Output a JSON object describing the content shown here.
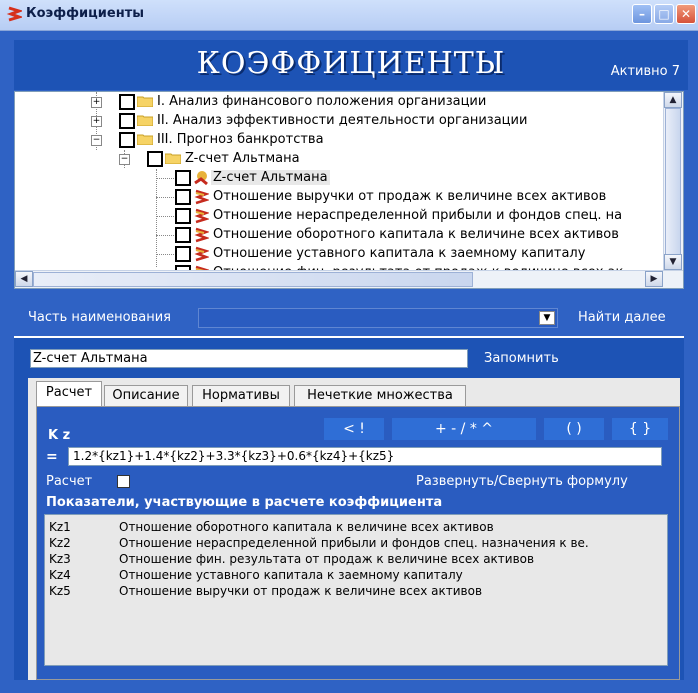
{
  "window": {
    "title": "Коэффициенты",
    "controls": [
      "minimize",
      "maximize",
      "close"
    ]
  },
  "banner": {
    "title": "КОЭФФИЦИЕНТЫ",
    "active": "Активно 7"
  },
  "tree": {
    "rows": [
      {
        "label": "I. Анализ финансового положения организации"
      },
      {
        "label": "II. Анализ эффективности деятельности организации"
      },
      {
        "label": "III. Прогноз банкротства"
      },
      {
        "label": "Z-счет Альтмана"
      },
      {
        "label": "Z-счет Альтмана"
      },
      {
        "label": "Отношение выручки от продаж к величине всех активов"
      },
      {
        "label": "Отношение нераспределенной прибыли и фондов спец. на"
      },
      {
        "label": "Отношение оборотного капитала к величине всех активов"
      },
      {
        "label": "Отношение уставного капитала к заемному капиталу"
      },
      {
        "label": "Отношение фин. результата от продаж к величине всех ак"
      }
    ]
  },
  "search": {
    "label": "Часть наименования",
    "find_next": "Найти далее"
  },
  "editor": {
    "name": "Z-счет Альтмана",
    "remember": "Запомнить"
  },
  "tabs": [
    "Расчет",
    "Описание",
    "Нормативы",
    "Нечеткие множества"
  ],
  "calc": {
    "var_label": "K z",
    "ops": [
      "< !",
      "+ - / * ^",
      "( )",
      "{ }"
    ],
    "eq": "=",
    "formula": "1.2*{kz1}+1.4*{kz2}+3.3*{kz3}+0.6*{kz4}+{kz5}",
    "calc_label": "Расчет",
    "toggle_formula": "Развернуть/Свернуть формулу",
    "params_header": "Показатели, участвующие в расчете коэффициента",
    "params": [
      {
        "code": "Kz1",
        "desc": "Отношение оборотного капитала к величине всех активов"
      },
      {
        "code": "Kz2",
        "desc": "Отношение нераспределенной прибыли и фондов спец. назначения к ве."
      },
      {
        "code": "Kz3",
        "desc": "Отношение фин. результата от продаж к величине всех активов"
      },
      {
        "code": "Kz4",
        "desc": "Отношение уставного капитала к заемному капиталу"
      },
      {
        "code": "Kz5",
        "desc": "Отношение выручки от продаж к величине всех активов"
      }
    ]
  }
}
